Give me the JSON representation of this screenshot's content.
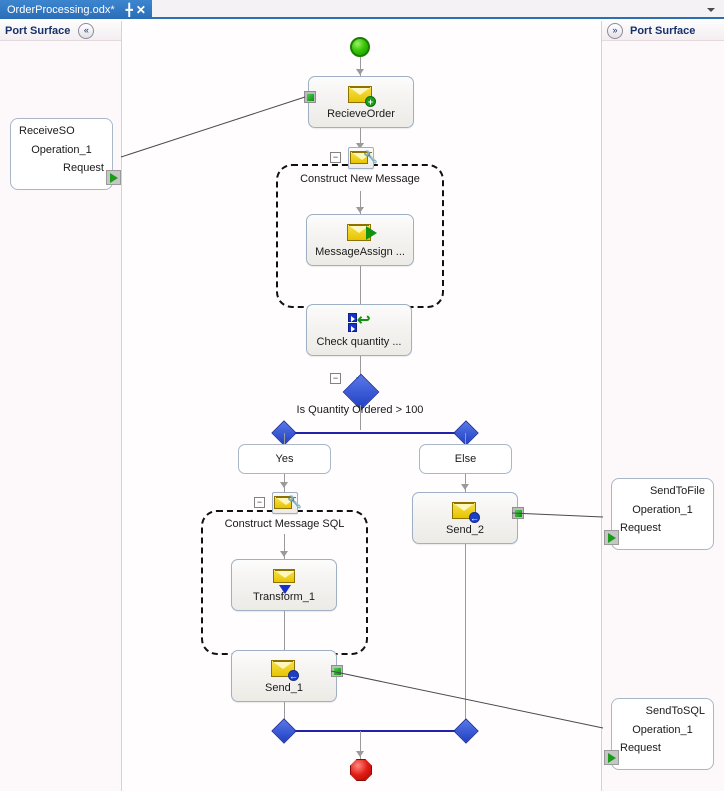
{
  "window": {
    "tab_title": "OrderProcessing.odx*",
    "pin_icon": "pin-icon",
    "close_icon": "close-icon",
    "dropdown_icon": "chevron-down-icon"
  },
  "left_panel": {
    "title": "Port Surface",
    "collapse_icon": "«",
    "port": {
      "name": "ReceiveSO",
      "operation": "Operation_1",
      "message": "Request"
    }
  },
  "right_panel": {
    "title": "Port Surface",
    "expand_icon": "»",
    "ports": [
      {
        "name": "SendToFile",
        "operation": "Operation_1",
        "message": "Request"
      },
      {
        "name": "SendToSQL",
        "operation": "Operation_1",
        "message": "Request"
      }
    ]
  },
  "orchestration": {
    "start_shape": "start-circle",
    "end_shape": "stop-octagon",
    "shapes": {
      "receive": {
        "label": "RecieveOrder",
        "icon": "receive-message-icon"
      },
      "construct_new_message": {
        "label": "Construct New Message",
        "icon": "construct-message-icon",
        "expander": "−"
      },
      "message_assignment": {
        "label": "MessageAssign ...",
        "icon": "message-assignment-icon"
      },
      "check_quantity": {
        "label": "Check  quantity ...",
        "icon": "expression-icon"
      },
      "decide": {
        "label": "Is Quantity Ordered > 100",
        "expander": "−"
      },
      "branch_yes": {
        "label": "Yes"
      },
      "branch_else": {
        "label": "Else"
      },
      "construct_message_sql": {
        "label": "Construct Message SQL",
        "icon": "construct-message-icon",
        "expander": "−"
      },
      "transform": {
        "label": "Transform_1",
        "icon": "transform-icon"
      },
      "send_1": {
        "label": "Send_1",
        "icon": "send-message-icon"
      },
      "send_2": {
        "label": "Send_2",
        "icon": "send-message-icon"
      }
    }
  },
  "colors": {
    "tab_active": "#2f78c4",
    "accent_border": "#2b6fb5",
    "decision_diamond": "#2b4fd6",
    "start_green": "#39c706",
    "stop_red": "#e21b13",
    "port_green": "#15a015",
    "panel_title": "#17316b"
  }
}
